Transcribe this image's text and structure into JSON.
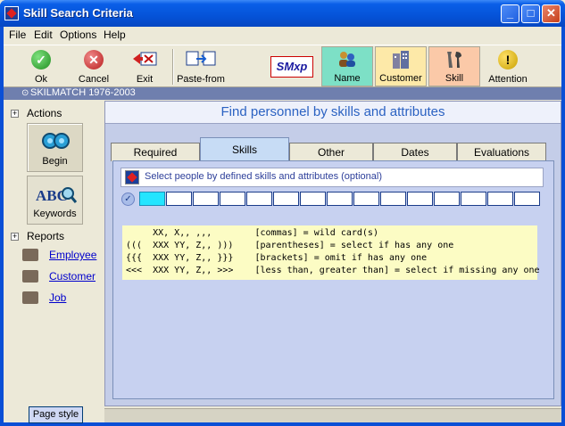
{
  "window": {
    "title": "Skill Search Criteria",
    "controls": {
      "minimize": "_",
      "maximize": "□",
      "close": "✕"
    }
  },
  "menubar": [
    {
      "label": "File"
    },
    {
      "label": "Edit"
    },
    {
      "label": "Options"
    },
    {
      "label": "Help"
    }
  ],
  "toolbar": {
    "ok": "Ok",
    "cancel": "Cancel",
    "exit": "Exit",
    "paste_from": "Paste-from",
    "logo": "SMxp",
    "name": "Name",
    "customer": "Customer",
    "skill": "Skill",
    "attention": "Attention"
  },
  "copyright": "SKILMATCH 1976-2003",
  "sidebar": {
    "actions_title": "Actions",
    "begin": "Begin",
    "keywords": "Keywords",
    "reports_title": "Reports",
    "reports": [
      {
        "label": "Employee"
      },
      {
        "label": "Customer"
      },
      {
        "label": "Job"
      }
    ],
    "page_style": "Page style"
  },
  "main": {
    "header": "Find personnel by skills and attributes",
    "tabs": [
      {
        "label": "Required"
      },
      {
        "label": "Skills"
      },
      {
        "label": "Other"
      },
      {
        "label": "Dates"
      },
      {
        "label": "Evaluations"
      }
    ],
    "active_tab": "Skills",
    "instruction": "Select people by defined skills and attributes (optional)",
    "slot_count": 15,
    "cheatsheet": [
      "     XX, X,, ,,,        [commas] = wild card(s)",
      "(((  XXX YY, Z,, )))    [parentheses] = select if has any one",
      "{{{  XXX YY, Z,, }}}    [brackets] = omit if has any one",
      "<<<  XXX YY, Z,, >>>    [less than, greater than] = select if missing any one"
    ]
  },
  "colors": {
    "accent_blue": "#2b62c2",
    "name_btn": "#7de0c6",
    "customer_btn": "#fde9a8",
    "skill_btn": "#fbc9a8",
    "first_slot": "#23e5ff",
    "cheatsheet_bg": "#fcfcc4"
  }
}
